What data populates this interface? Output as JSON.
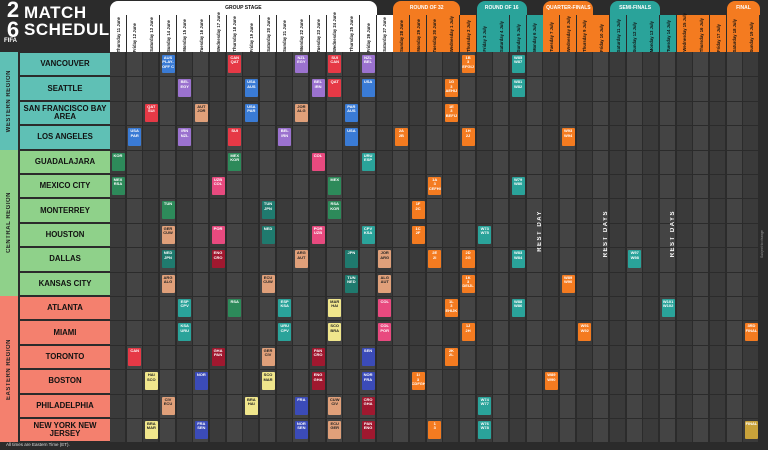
{
  "logo": {
    "year_top": "2",
    "year_bottom": "6",
    "fifa": "FIFA",
    "line1": "MATCH",
    "line2": "SCHEDULE"
  },
  "stages": [
    {
      "name": "GROUP STAGE",
      "color": "#ffffff",
      "text": "#111111"
    },
    {
      "name": "ROUND OF 32",
      "color": "#f47b20",
      "text": "#ffffff"
    },
    {
      "name": "ROUND OF 16",
      "color": "#2aa39a",
      "text": "#ffffff"
    },
    {
      "name": "QUARTER-FINALS",
      "color": "#f47b20",
      "text": "#ffffff"
    },
    {
      "name": "SEMI-FINALS",
      "color": "#2aa39a",
      "text": "#ffffff"
    },
    {
      "name": "FINAL",
      "color": "#f47b20",
      "text": "#ffffff"
    }
  ],
  "dates": [
    "Thursday 11 June",
    "Friday 12 June",
    "Saturday 13 June",
    "Sunday 14 June",
    "Monday 15 June",
    "Tuesday 16 June",
    "Wednesday 17 June",
    "Thursday 18 June",
    "Friday 19 June",
    "Saturday 20 June",
    "Sunday 21 June",
    "Monday 22 June",
    "Tuesday 23 June",
    "Wednesday 24 June",
    "Thursday 25 June",
    "Friday 26 June",
    "Saturday 27 June",
    "Sunday 28 June",
    "Monday 29 June",
    "Tuesday 30 June",
    "Wednesday 1 July",
    "Thursday 2 July",
    "Friday 3 July",
    "Saturday 4 July",
    "Sunday 5 July",
    "Monday 6 July",
    "Tuesday 7 July",
    "Wednesday 8 July",
    "Thursday 9 July",
    "Friday 10 July",
    "Saturday 11 July",
    "Sunday 12 July",
    "Monday 13 July",
    "Tuesday 14 July",
    "Wednesday 15 July",
    "Thursday 16 July",
    "Friday 17 July",
    "Saturday 18 July",
    "Sunday 19 July"
  ],
  "regions": [
    {
      "name": "WESTERN REGION",
      "color": "#5fc0b5"
    },
    {
      "name": "CENTRAL REGION",
      "color": "#8fd18a"
    },
    {
      "name": "EASTERN REGION",
      "color": "#f4806e"
    }
  ],
  "cities": [
    "VANCOUVER",
    "SEATTLE",
    "SAN FRANCISCO BAY AREA",
    "LOS ANGELES",
    "GUADALAJARA",
    "MEXICO CITY",
    "MONTERREY",
    "HOUSTON",
    "DALLAS",
    "KANSAS CITY",
    "ATLANTA",
    "MIAMI",
    "TORONTO",
    "BOSTON",
    "PHILADELPHIA",
    "NEW YORK NEW JERSEY"
  ],
  "matches": [
    {
      "row": 0,
      "col": 3,
      "c": "#3a7bd5",
      "t": "AUS\nPLAY-OFF C"
    },
    {
      "row": 0,
      "col": 7,
      "c": "#e63946",
      "t": "CAN\nQAT"
    },
    {
      "row": 0,
      "col": 11,
      "c": "#9b72cf",
      "t": "NZL\nEGY"
    },
    {
      "row": 0,
      "col": 13,
      "c": "#e63946",
      "t": "SUI\nCAN"
    },
    {
      "row": 0,
      "col": 15,
      "c": "#9b72cf",
      "t": "NZL\nBEL"
    },
    {
      "row": 0,
      "col": 21,
      "c": "#f47b20",
      "t": "1B\n3\nEFGIJ"
    },
    {
      "row": 0,
      "col": 24,
      "c": "#2aa39a",
      "t": "W85\nW87"
    },
    {
      "row": 1,
      "col": 4,
      "c": "#9b72cf",
      "t": "BEL\nEGY"
    },
    {
      "row": 1,
      "col": 8,
      "c": "#3a7bd5",
      "t": "USA\nAUS"
    },
    {
      "row": 1,
      "col": 12,
      "c": "#9b72cf",
      "t": "BEL\nIRN"
    },
    {
      "row": 1,
      "col": 13,
      "c": "#e63946",
      "t": "QAT"
    },
    {
      "row": 1,
      "col": 15,
      "c": "#3a7bd5",
      "t": "USA"
    },
    {
      "row": 1,
      "col": 20,
      "c": "#f47b20",
      "t": "1G\n3\nAEHIJ"
    },
    {
      "row": 1,
      "col": 24,
      "c": "#2aa39a",
      "t": "W81\nW82"
    },
    {
      "row": 2,
      "col": 2,
      "c": "#e63946",
      "t": "QAT\nSUI"
    },
    {
      "row": 2,
      "col": 5,
      "c": "#e0a07a",
      "t": "AUT\nJOR"
    },
    {
      "row": 2,
      "col": 8,
      "c": "#3a7bd5",
      "t": "USA\nPAR"
    },
    {
      "row": 2,
      "col": 11,
      "c": "#e0a07a",
      "t": "JOR\nALG"
    },
    {
      "row": 2,
      "col": 14,
      "c": "#3a7bd5",
      "t": "PAR\nAUS"
    },
    {
      "row": 2,
      "col": 20,
      "c": "#f47b20",
      "t": "1E\n3\nBEFIJ"
    },
    {
      "row": 3,
      "col": 1,
      "c": "#3a7bd5",
      "t": "USA\nPAR"
    },
    {
      "row": 3,
      "col": 4,
      "c": "#9b72cf",
      "t": "IRN\nNZL"
    },
    {
      "row": 3,
      "col": 7,
      "c": "#e63946",
      "t": "SUI"
    },
    {
      "row": 3,
      "col": 10,
      "c": "#9b72cf",
      "t": "BEL\nIRN"
    },
    {
      "row": 3,
      "col": 14,
      "c": "#3a7bd5",
      "t": "USA"
    },
    {
      "row": 3,
      "col": 17,
      "c": "#f47b20",
      "t": "2A\n2B"
    },
    {
      "row": 3,
      "col": 21,
      "c": "#f47b20",
      "t": "1H\n2J"
    },
    {
      "row": 3,
      "col": 27,
      "c": "#f47b20",
      "t": "W93\nW94"
    },
    {
      "row": 4,
      "col": 0,
      "c": "#2d8a5a",
      "t": "KOR"
    },
    {
      "row": 4,
      "col": 7,
      "c": "#2d8a5a",
      "t": "MEX\nKOR"
    },
    {
      "row": 4,
      "col": 12,
      "c": "#e84a7f",
      "t": "COL"
    },
    {
      "row": 4,
      "col": 15,
      "c": "#2aa39a",
      "t": "URU\nESP"
    },
    {
      "row": 5,
      "col": 0,
      "c": "#2d8a5a",
      "t": "MEX\nRSA"
    },
    {
      "row": 5,
      "col": 6,
      "c": "#e84a7f",
      "t": "UZB\nCOL"
    },
    {
      "row": 5,
      "col": 13,
      "c": "#2d8a5a",
      "t": "MEX"
    },
    {
      "row": 5,
      "col": 19,
      "c": "#f47b20",
      "t": "1A\n3\nCEFHI"
    },
    {
      "row": 5,
      "col": 24,
      "c": "#2aa39a",
      "t": "W79\nW80"
    },
    {
      "row": 6,
      "col": 3,
      "c": "#2d8a5a",
      "t": "TUN"
    },
    {
      "row": 6,
      "col": 9,
      "c": "#1f7a6e",
      "t": "TUN\nJPN"
    },
    {
      "row": 6,
      "col": 13,
      "c": "#2d8a5a",
      "t": "RSA\nKOR"
    },
    {
      "row": 6,
      "col": 18,
      "c": "#f47b20",
      "t": "1F\n2C"
    },
    {
      "row": 7,
      "col": 3,
      "c": "#e0a07a",
      "t": "GER\nCUW"
    },
    {
      "row": 7,
      "col": 6,
      "c": "#e84a7f",
      "t": "POR"
    },
    {
      "row": 7,
      "col": 9,
      "c": "#1f7a6e",
      "t": "NED"
    },
    {
      "row": 7,
      "col": 12,
      "c": "#e84a7f",
      "t": "POR\nUZB"
    },
    {
      "row": 7,
      "col": 15,
      "c": "#2aa39a",
      "t": "CPV\nKSA"
    },
    {
      "row": 7,
      "col": 18,
      "c": "#f47b20",
      "t": "1C\n2F"
    },
    {
      "row": 7,
      "col": 22,
      "c": "#2aa39a",
      "t": "W73\nW75"
    },
    {
      "row": 8,
      "col": 3,
      "c": "#1f7a6e",
      "t": "NED\nJPN"
    },
    {
      "row": 8,
      "col": 6,
      "c": "#a0182f",
      "t": "ENG\nCRO"
    },
    {
      "row": 8,
      "col": 11,
      "c": "#e0a07a",
      "t": "ARG\nAUT"
    },
    {
      "row": 8,
      "col": 14,
      "c": "#1f7a6e",
      "t": "JPN"
    },
    {
      "row": 8,
      "col": 16,
      "c": "#e0a07a",
      "t": "JOR\nARG"
    },
    {
      "row": 8,
      "col": 19,
      "c": "#f47b20",
      "t": "2E\n2I"
    },
    {
      "row": 8,
      "col": 21,
      "c": "#f47b20",
      "t": "2D\n2G"
    },
    {
      "row": 8,
      "col": 24,
      "c": "#2aa39a",
      "t": "W83\nW84"
    },
    {
      "row": 8,
      "col": 31,
      "c": "#2aa39a",
      "t": "W97\nW98"
    },
    {
      "row": 9,
      "col": 3,
      "c": "#e0a07a",
      "t": "ARG\nALG"
    },
    {
      "row": 9,
      "col": 9,
      "c": "#e0a07a",
      "t": "ECU\nCUW"
    },
    {
      "row": 9,
      "col": 14,
      "c": "#1f7a6e",
      "t": "TUN\nNED"
    },
    {
      "row": 9,
      "col": 16,
      "c": "#e0a07a",
      "t": "ALG\nAUT"
    },
    {
      "row": 9,
      "col": 21,
      "c": "#f47b20",
      "t": "1K\n3\nDEIJL"
    },
    {
      "row": 9,
      "col": 27,
      "c": "#f47b20",
      "t": "W89\nW90"
    },
    {
      "row": 10,
      "col": 4,
      "c": "#2aa39a",
      "t": "ESP\nCPV"
    },
    {
      "row": 10,
      "col": 7,
      "c": "#2d8a5a",
      "t": "RSA"
    },
    {
      "row": 10,
      "col": 10,
      "c": "#2aa39a",
      "t": "ESP\nKSA"
    },
    {
      "row": 10,
      "col": 13,
      "c": "#f0e68c",
      "t": "MAR\nHAI"
    },
    {
      "row": 10,
      "col": 16,
      "c": "#e84a7f",
      "t": "COL"
    },
    {
      "row": 10,
      "col": 20,
      "c": "#f47b20",
      "t": "1L\n3\nEHIJK"
    },
    {
      "row": 10,
      "col": 24,
      "c": "#2aa39a",
      "t": "W88\nW86"
    },
    {
      "row": 10,
      "col": 33,
      "c": "#2aa39a",
      "t": "W101\nW102"
    },
    {
      "row": 11,
      "col": 4,
      "c": "#2aa39a",
      "t": "KSA\nURU"
    },
    {
      "row": 11,
      "col": 10,
      "c": "#2aa39a",
      "t": "URU\nCPV"
    },
    {
      "row": 11,
      "col": 13,
      "c": "#f0e68c",
      "t": "SCO\nBRA"
    },
    {
      "row": 11,
      "col": 16,
      "c": "#e84a7f",
      "t": "COL\nPOR"
    },
    {
      "row": 11,
      "col": 21,
      "c": "#f47b20",
      "t": "1J\n2H"
    },
    {
      "row": 11,
      "col": 28,
      "c": "#f47b20",
      "t": "W91\nW92"
    },
    {
      "row": 11,
      "col": 38,
      "c": "#f47b20",
      "t": "3RD\nFINAL"
    },
    {
      "row": 12,
      "col": 1,
      "c": "#e63946",
      "t": "CAN"
    },
    {
      "row": 12,
      "col": 6,
      "c": "#a0182f",
      "t": "GHA\nPAN"
    },
    {
      "row": 12,
      "col": 9,
      "c": "#e0a07a",
      "t": "GER\nCIV"
    },
    {
      "row": 12,
      "col": 12,
      "c": "#a0182f",
      "t": "PAN\nCRO"
    },
    {
      "row": 12,
      "col": 15,
      "c": "#3b4bb8",
      "t": "SEN"
    },
    {
      "row": 12,
      "col": 20,
      "c": "#f47b20",
      "t": "2K\n2L"
    },
    {
      "row": 13,
      "col": 2,
      "c": "#f0e68c",
      "t": "HAI\nSCO"
    },
    {
      "row": 13,
      "col": 5,
      "c": "#3b4bb8",
      "t": "NOR"
    },
    {
      "row": 13,
      "col": 9,
      "c": "#f0e68c",
      "t": "SCO\nMAR"
    },
    {
      "row": 13,
      "col": 12,
      "c": "#a0182f",
      "t": "ENG\nGHA"
    },
    {
      "row": 13,
      "col": 15,
      "c": "#3b4bb8",
      "t": "NOR\nFRA"
    },
    {
      "row": 13,
      "col": 18,
      "c": "#f47b20",
      "t": "1I\n3\nCDFGH"
    },
    {
      "row": 13,
      "col": 26,
      "c": "#f47b20",
      "t": "W89\nW90"
    },
    {
      "row": 14,
      "col": 3,
      "c": "#e0a07a",
      "t": "CIV\nECU"
    },
    {
      "row": 14,
      "col": 8,
      "c": "#f0e68c",
      "t": "BRA\nHAI"
    },
    {
      "row": 14,
      "col": 11,
      "c": "#3b4bb8",
      "t": "FRA"
    },
    {
      "row": 14,
      "col": 13,
      "c": "#e0a07a",
      "t": "CUW\nCIV"
    },
    {
      "row": 14,
      "col": 15,
      "c": "#a0182f",
      "t": "CRO\nGHA"
    },
    {
      "row": 14,
      "col": 22,
      "c": "#2aa39a",
      "t": "W74\nW77"
    },
    {
      "row": 15,
      "col": 2,
      "c": "#f0e68c",
      "t": "BRA\nMAR"
    },
    {
      "row": 15,
      "col": 5,
      "c": "#3b4bb8",
      "t": "FRA\nSEN"
    },
    {
      "row": 15,
      "col": 11,
      "c": "#3b4bb8",
      "t": "NOR\nSEN"
    },
    {
      "row": 15,
      "col": 13,
      "c": "#e0a07a",
      "t": "ECU\nGER"
    },
    {
      "row": 15,
      "col": 15,
      "c": "#a0182f",
      "t": "PAN\nENG"
    },
    {
      "row": 15,
      "col": 19,
      "c": "#f47b20",
      "t": "1\n3"
    },
    {
      "row": 15,
      "col": 22,
      "c": "#2aa39a",
      "t": "W76\nW78"
    },
    {
      "row": 15,
      "col": 38,
      "c": "#c8a23a",
      "t": "FINAL"
    }
  ],
  "rest": [
    "REST DAY",
    "REST DAYS",
    "REST DAYS"
  ],
  "footnote": "All times are Eastern Time (ET).",
  "side_note": "Subject to change"
}
